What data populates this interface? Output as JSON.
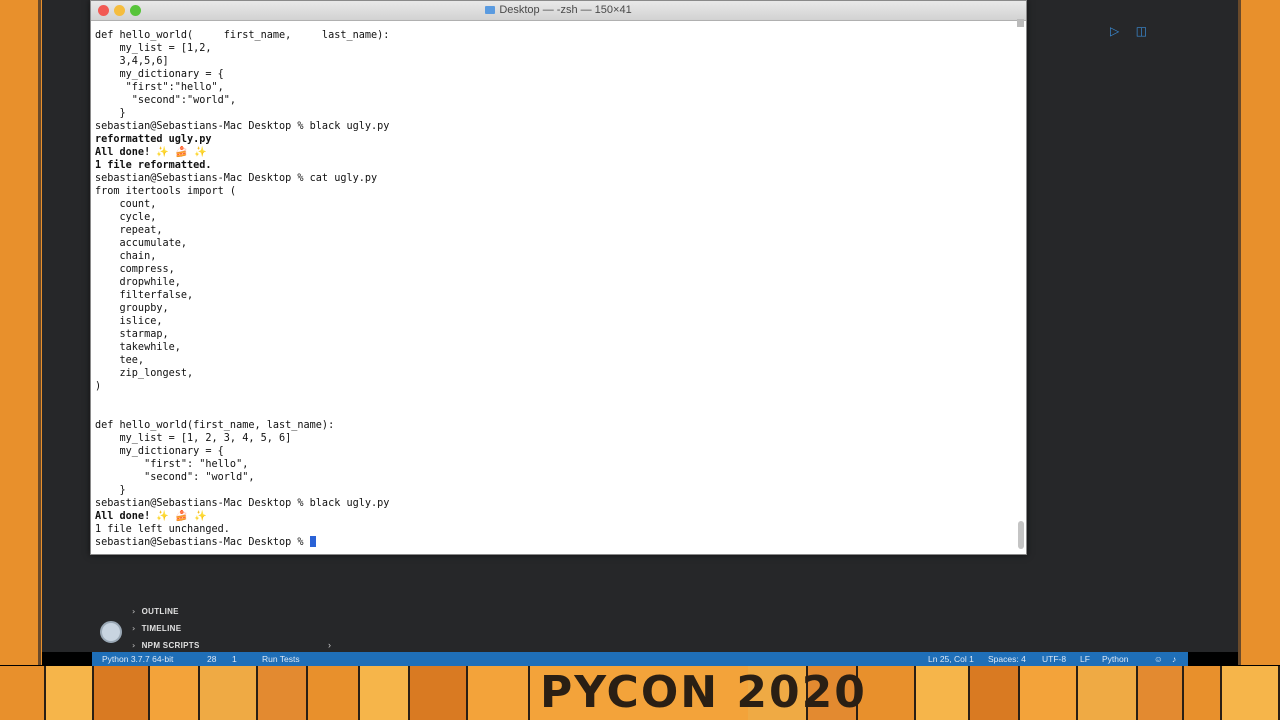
{
  "terminal": {
    "title": "Desktop — -zsh — 150×41",
    "lines": [
      {
        "text": "def hello_world(     first_name,     last_name):",
        "bold": false
      },
      {
        "text": "    my_list = [1,2,",
        "bold": false
      },
      {
        "text": "    3,4,5,6]",
        "bold": false
      },
      {
        "text": "    my_dictionary = {",
        "bold": false
      },
      {
        "text": "     \"first\":\"hello\",",
        "bold": false
      },
      {
        "text": "      \"second\":\"world\",",
        "bold": false
      },
      {
        "text": "    }",
        "bold": false
      },
      {
        "text": "sebastian@Sebastians-Mac Desktop % black ugly.py",
        "bold": false
      },
      {
        "text": "reformatted ugly.py",
        "bold": true
      },
      {
        "text": "All done! ✨ 🍰 ✨",
        "bold": true
      },
      {
        "text": "1 file reformatted.",
        "bold": true
      },
      {
        "text": "sebastian@Sebastians-Mac Desktop % cat ugly.py",
        "bold": false
      },
      {
        "text": "from itertools import (",
        "bold": false
      },
      {
        "text": "    count,",
        "bold": false
      },
      {
        "text": "    cycle,",
        "bold": false
      },
      {
        "text": "    repeat,",
        "bold": false
      },
      {
        "text": "    accumulate,",
        "bold": false
      },
      {
        "text": "    chain,",
        "bold": false
      },
      {
        "text": "    compress,",
        "bold": false
      },
      {
        "text": "    dropwhile,",
        "bold": false
      },
      {
        "text": "    filterfalse,",
        "bold": false
      },
      {
        "text": "    groupby,",
        "bold": false
      },
      {
        "text": "    islice,",
        "bold": false
      },
      {
        "text": "    starmap,",
        "bold": false
      },
      {
        "text": "    takewhile,",
        "bold": false
      },
      {
        "text": "    tee,",
        "bold": false
      },
      {
        "text": "    zip_longest,",
        "bold": false
      },
      {
        "text": ")",
        "bold": false
      },
      {
        "text": "",
        "bold": false
      },
      {
        "text": "",
        "bold": false
      },
      {
        "text": "def hello_world(first_name, last_name):",
        "bold": false
      },
      {
        "text": "    my_list = [1, 2, 3, 4, 5, 6]",
        "bold": false
      },
      {
        "text": "    my_dictionary = {",
        "bold": false
      },
      {
        "text": "        \"first\": \"hello\",",
        "bold": false
      },
      {
        "text": "        \"second\": \"world\",",
        "bold": false
      },
      {
        "text": "    }",
        "bold": false
      },
      {
        "text": "sebastian@Sebastians-Mac Desktop % black ugly.py",
        "bold": false
      },
      {
        "text": "All done! ✨ 🍰 ✨",
        "bold": true
      },
      {
        "text": "1 file left unchanged.",
        "bold": false
      }
    ],
    "prompt": "sebastian@Sebastians-Mac Desktop % "
  },
  "sidebar": {
    "sections": [
      "OUTLINE",
      "TIMELINE",
      "NPM SCRIPTS"
    ]
  },
  "statusbar": {
    "python": "Python 3.7.7 64-bit",
    "problems": "28",
    "warnings": "1",
    "run_tests": "Run Tests",
    "position": "Ln 25, Col 1",
    "spaces": "Spaces: 4",
    "encoding": "UTF-8",
    "eol": "LF",
    "language": "Python"
  },
  "banner": {
    "text": "PYCON 2020"
  },
  "icons": [
    "run-icon",
    "split-editor-icon",
    "gear-icon",
    "chevron-right-icon",
    "bell-icon",
    "feedback-icon"
  ],
  "colors": {
    "statusbar": "#1f6fb8",
    "frame_orange": "#e8902c",
    "banner_orange": "#f3a33a",
    "terminal_bg": "#ffffff",
    "editor_bg": "#262729"
  }
}
